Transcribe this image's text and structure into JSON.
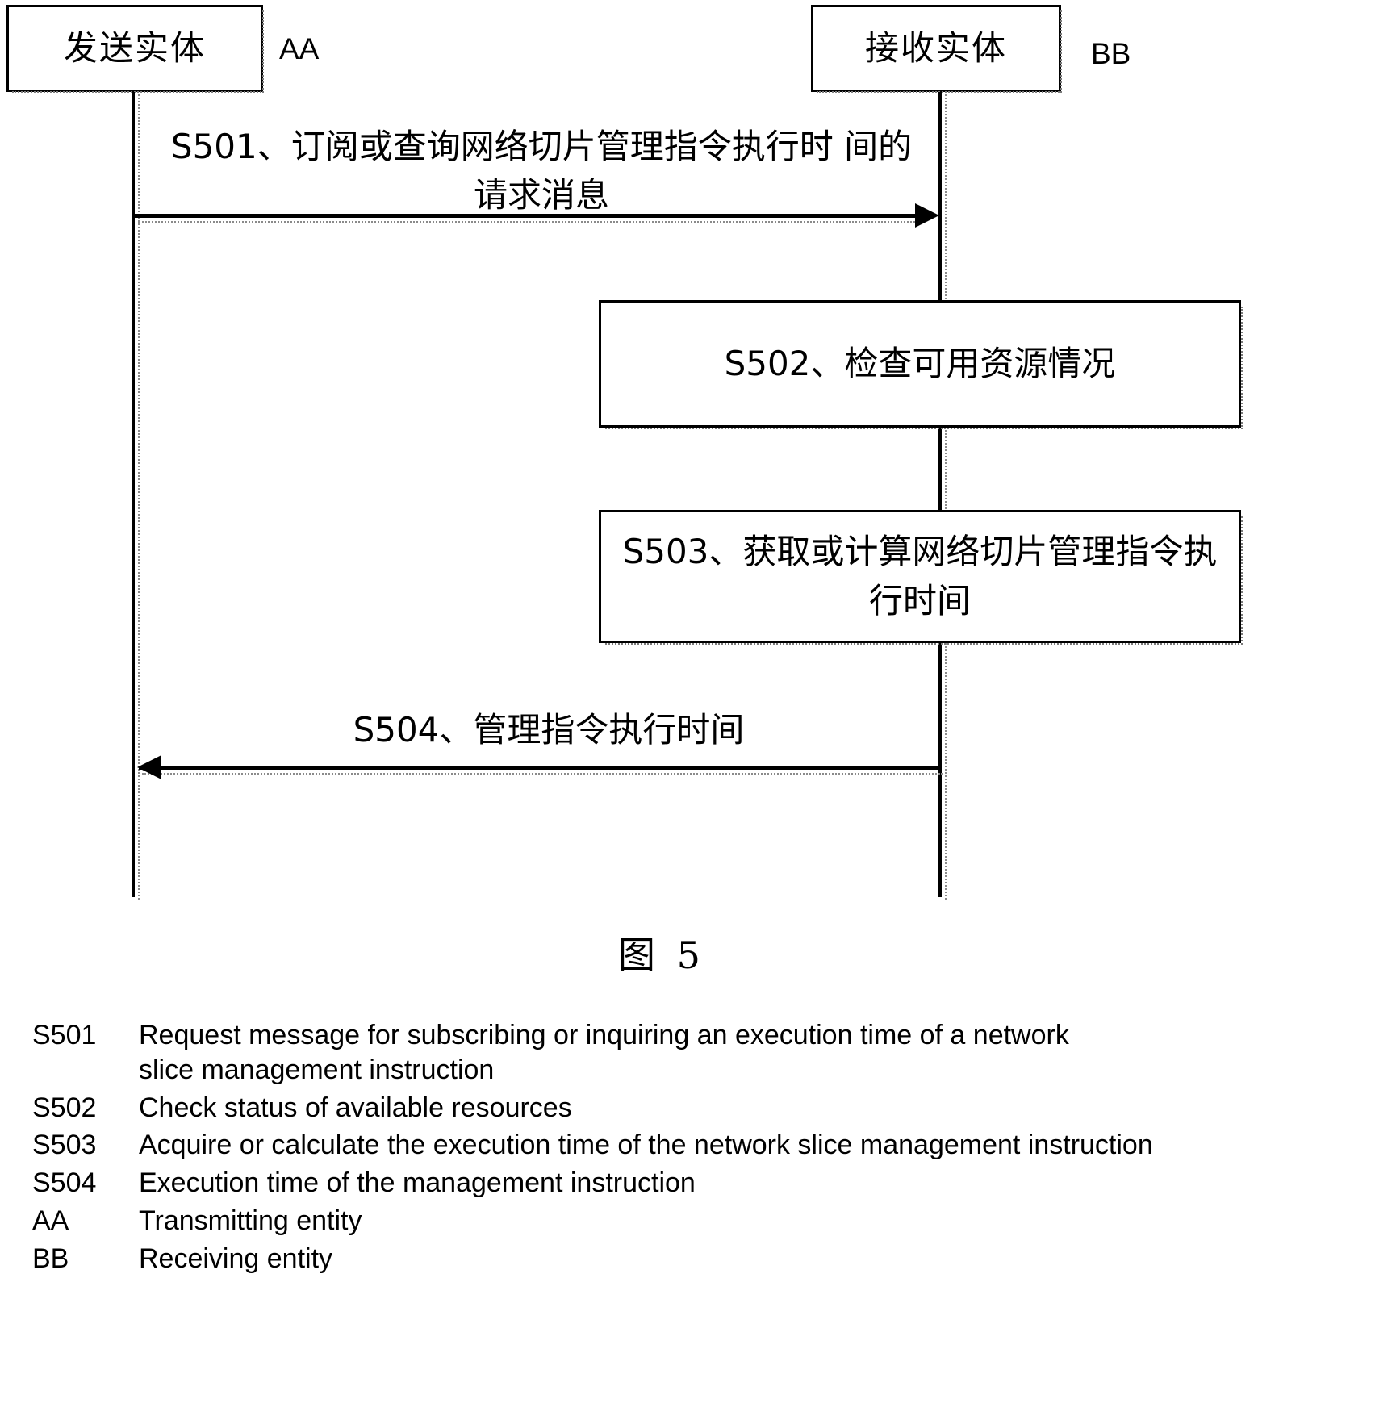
{
  "figure": {
    "caption": "图 5",
    "participants": [
      {
        "id": "AA",
        "label": "发送实体",
        "tag": "AA"
      },
      {
        "id": "BB",
        "label": "接收实体",
        "tag": "BB"
      }
    ],
    "messages": [
      {
        "id": "S501",
        "direction": "right",
        "text": "S501、订阅或查询网络切片管理指令执行时\n间的请求消息"
      },
      {
        "id": "S504",
        "direction": "left",
        "text": "S504、管理指令执行时间"
      }
    ],
    "actions": [
      {
        "id": "S502",
        "text": "S502、检查可用资源情况"
      },
      {
        "id": "S503",
        "text": "S503、获取或计算网络切片管理指令执\n行时间"
      }
    ]
  },
  "legend": {
    "rows": [
      {
        "key": "S501",
        "desc": "Request message for subscribing or inquiring an execution time of a network\n   slice management instruction"
      },
      {
        "key": "S502",
        "desc": "Check status of available resources"
      },
      {
        "key": "S503",
        "desc": "Acquire or calculate the execution time of the network slice management instruction"
      },
      {
        "key": "S504",
        "desc": "Execution time of the management instruction"
      },
      {
        "key": "AA",
        "desc": "Transmitting entity"
      },
      {
        "key": "BB",
        "desc": "Receiving entity"
      }
    ]
  }
}
